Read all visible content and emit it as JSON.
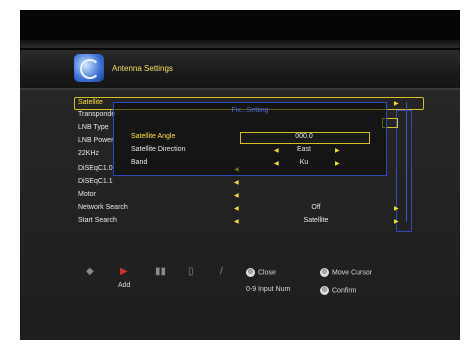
{
  "header": {
    "title": "Antenna Settings"
  },
  "menu": {
    "items": [
      {
        "label": "Satellite",
        "value": "",
        "left_arrow": false,
        "right_arrow": true,
        "selected": true
      },
      {
        "label": "Transponde",
        "value": "",
        "left_arrow": false,
        "right_arrow": false,
        "selected": false
      },
      {
        "label": "LNB Type",
        "value": "",
        "left_arrow": false,
        "right_arrow": false,
        "selected": false
      },
      {
        "label": "LNB Power",
        "value": "",
        "left_arrow": false,
        "right_arrow": false,
        "selected": false
      },
      {
        "label": "22KHz",
        "value": "",
        "left_arrow": false,
        "right_arrow": false,
        "selected": false
      },
      {
        "label": "DiSEqC1.0",
        "value": "",
        "left_arrow": true,
        "right_arrow": false,
        "selected": false
      },
      {
        "label": "DiSEqC1.1",
        "value": "",
        "left_arrow": true,
        "right_arrow": false,
        "selected": false
      },
      {
        "label": "Motor",
        "value": "",
        "left_arrow": true,
        "right_arrow": false,
        "selected": false
      },
      {
        "label": "Network Search",
        "value": "Off",
        "left_arrow": true,
        "right_arrow": true,
        "selected": false
      },
      {
        "label": "Start Search",
        "value": "Satellite",
        "left_arrow": true,
        "right_arrow": true,
        "selected": false
      }
    ]
  },
  "popup": {
    "title": "Fix...Setting",
    "rows": [
      {
        "label": "Satellite Angle",
        "value": "000.0",
        "selected": true
      },
      {
        "label": "Satellite Direction",
        "value": "East",
        "selected": false
      },
      {
        "label": "Band",
        "value": "Ku",
        "selected": false
      }
    ]
  },
  "footer": {
    "add_label": "Add",
    "close_label": "Close",
    "move_cursor_label": "Move Cursor",
    "input_num_label": "0-9  Input Num",
    "confirm_label": "Confirm",
    "icons": [
      "delete-icon",
      "add-icon",
      "signal-icon",
      "info-icon",
      "edit-icon"
    ]
  },
  "colors": {
    "highlight": "#ffe040",
    "frame": "#2e4ab8",
    "accent": "#d4c020"
  }
}
